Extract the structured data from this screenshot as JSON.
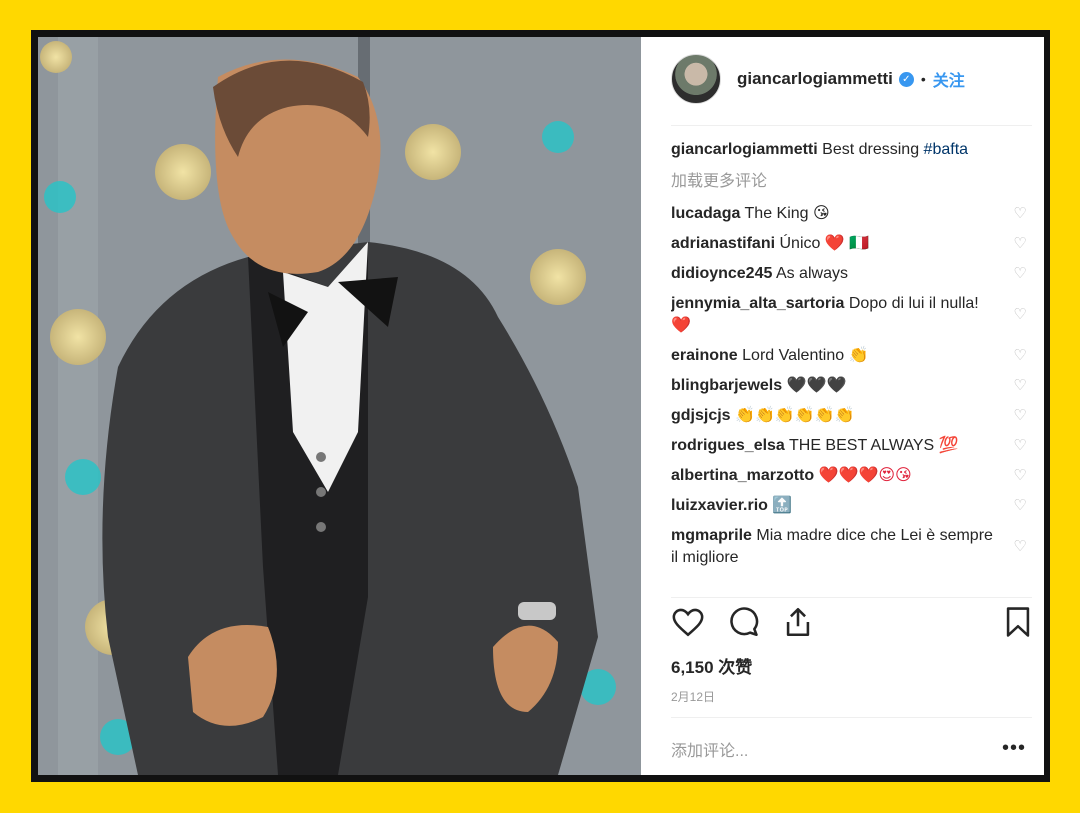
{
  "post": {
    "username": "giancarlogiammetti",
    "follow": "关注",
    "caption_user": "giancarlogiammetti",
    "caption_text": "Best dressing",
    "caption_tag": "#bafta",
    "load_more": "加载更多评论",
    "likes": "6,150 次赞",
    "date": "2月12日",
    "add_comment_placeholder": "添加评论...",
    "more_icon": "•••"
  },
  "comments": [
    {
      "user": "lucadaga",
      "text": "The King",
      "emoji": "😘"
    },
    {
      "user": "adrianastifani",
      "text": "Único",
      "emoji": "❤️ 🇮🇹"
    },
    {
      "user": "didioynce245",
      "text": "As always",
      "emoji": ""
    },
    {
      "user": "jennymia_alta_sartoria",
      "text": "Dopo di lui il nulla!",
      "emoji": "❤️"
    },
    {
      "user": "erainone",
      "text": "Lord Valentino",
      "emoji": "👏"
    },
    {
      "user": "blingbarjewels",
      "text": "",
      "emoji": "🖤🖤🖤"
    },
    {
      "user": "gdjsjcjs",
      "text": "",
      "emoji": "👏👏👏👏👏👏"
    },
    {
      "user": "rodrigues_elsa",
      "text": "THE BEST ALWAYS",
      "emoji": "💯"
    },
    {
      "user": "albertina_marzotto",
      "text": "",
      "emoji": "❤️❤️❤️😍😘"
    },
    {
      "user": "luizxavier.rio",
      "text": "",
      "emoji": "🔝"
    },
    {
      "user": "mgmaprile",
      "text": "Mia madre dice che Lei è sempre il migliore",
      "emoji": ""
    }
  ],
  "icons": [
    "like-icon",
    "comment-icon",
    "share-icon",
    "bookmark-icon",
    "verified-icon",
    "comment-heart-icon"
  ],
  "colors": {
    "background": "#FFD800",
    "link": "#3897f0",
    "frame": "#111111"
  }
}
